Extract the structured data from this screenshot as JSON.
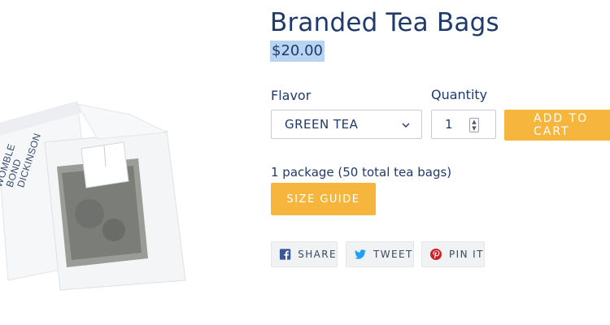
{
  "product": {
    "title": "Branded Tea Bags",
    "price": "$20.00",
    "description": "1 package (50 total tea bags)",
    "packet_brand_lines": [
      "WOMBLE",
      "BOND",
      "DICKINSON"
    ]
  },
  "form": {
    "flavor_label": "Flavor",
    "flavor_selected": "GREEN TEA",
    "quantity_label": "Quantity",
    "quantity_value": "1",
    "add_to_cart_label": "ADD TO CART"
  },
  "buttons": {
    "size_guide_label": "SIZE GUIDE"
  },
  "share": {
    "facebook_label": "SHARE",
    "twitter_label": "TWEET",
    "pinterest_label": "PIN IT"
  },
  "colors": {
    "accent": "#f6b63d",
    "text": "#1f3a6b",
    "selection": "#b9d3f3",
    "facebook": "#3b5998",
    "twitter": "#1da1f2",
    "pinterest": "#cb2027"
  },
  "icons": {
    "select": "chevron-down-icon",
    "quantity": "spinner-icon",
    "facebook": "facebook-icon",
    "twitter": "twitter-icon",
    "pinterest": "pinterest-icon"
  }
}
